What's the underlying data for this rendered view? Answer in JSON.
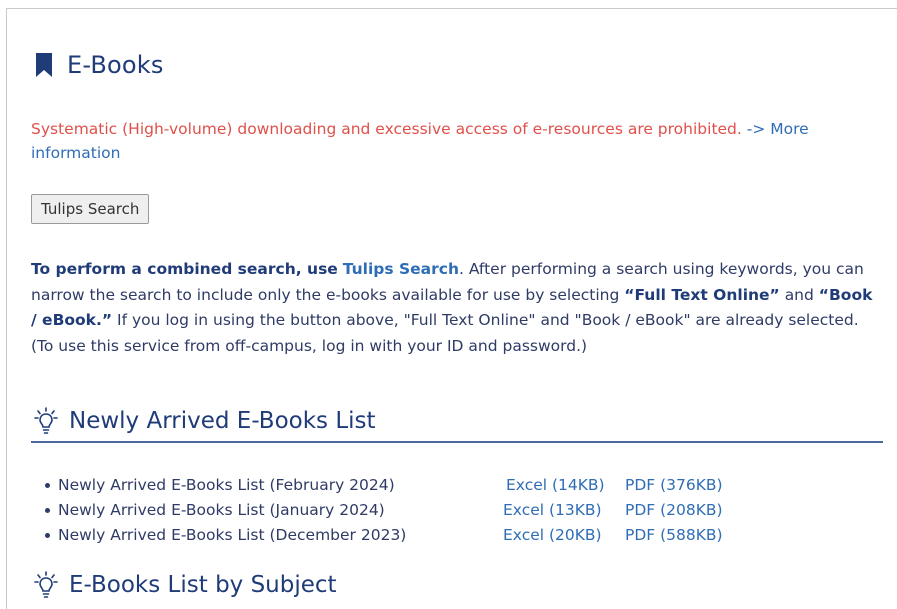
{
  "header": {
    "title": "E-Books"
  },
  "notice": {
    "warning": "Systematic (High-volume) downloading and excessive access of e-resources are prohibited.",
    "more_link": "-> More information"
  },
  "tulips_button": "Tulips Search",
  "description": {
    "bold1": "To perform a combined search, use",
    "link": "Tulips Search",
    "text1": ". After performing a search using keywords, you can narrow the search to include only the e-books available for use by selecting",
    "bold2": "“Full Text Online”",
    "text2": "and",
    "bold3": "“Book / eBook.”",
    "text3": "If you log in using the button above, \"Full Text Online\" and \"Book / eBook\" are already selected. (To use this service from off-campus, log in with your ID and password.)"
  },
  "sections": {
    "newly_arrived": "Newly Arrived E-Books List",
    "by_subject": "E-Books List by Subject"
  },
  "lists": [
    {
      "name": "Newly Arrived E-Books List (February 2024)",
      "excel": "Excel (14KB)",
      "pdf": "PDF (376KB)"
    },
    {
      "name": "Newly Arrived E-Books List (January 2024)",
      "excel": "Excel (13KB)",
      "pdf": "PDF (208KB)"
    },
    {
      "name": "Newly Arrived E-Books List (December 2023)",
      "excel": "Excel (20KB)",
      "pdf": "PDF (588KB)"
    }
  ]
}
